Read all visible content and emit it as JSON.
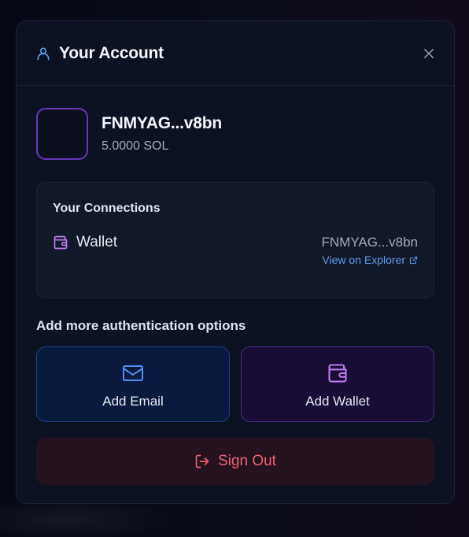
{
  "modal": {
    "title": "Your Account",
    "icons": {
      "title": "user-icon",
      "close": "close-icon"
    }
  },
  "account": {
    "address": "FNMYAG...v8bn",
    "balance": "5.0000 SOL"
  },
  "connections": {
    "title": "Your Connections",
    "items": [
      {
        "label": "Wallet",
        "icon": "wallet-icon",
        "address": "FNMYAG...v8bn",
        "link_label": "View on Explorer"
      }
    ]
  },
  "auth_options": {
    "title": "Add more authentication options",
    "buttons": [
      {
        "label": "Add Email",
        "icon": "mail-icon"
      },
      {
        "label": "Add Wallet",
        "icon": "wallet-icon"
      }
    ]
  },
  "sign_out": {
    "label": "Sign Out",
    "icon": "log-out-icon"
  },
  "colors": {
    "accent_blue": "#5a9df0",
    "accent_purple": "#c07cf0",
    "danger": "#f06070",
    "modal_bg": "#0c1222"
  }
}
